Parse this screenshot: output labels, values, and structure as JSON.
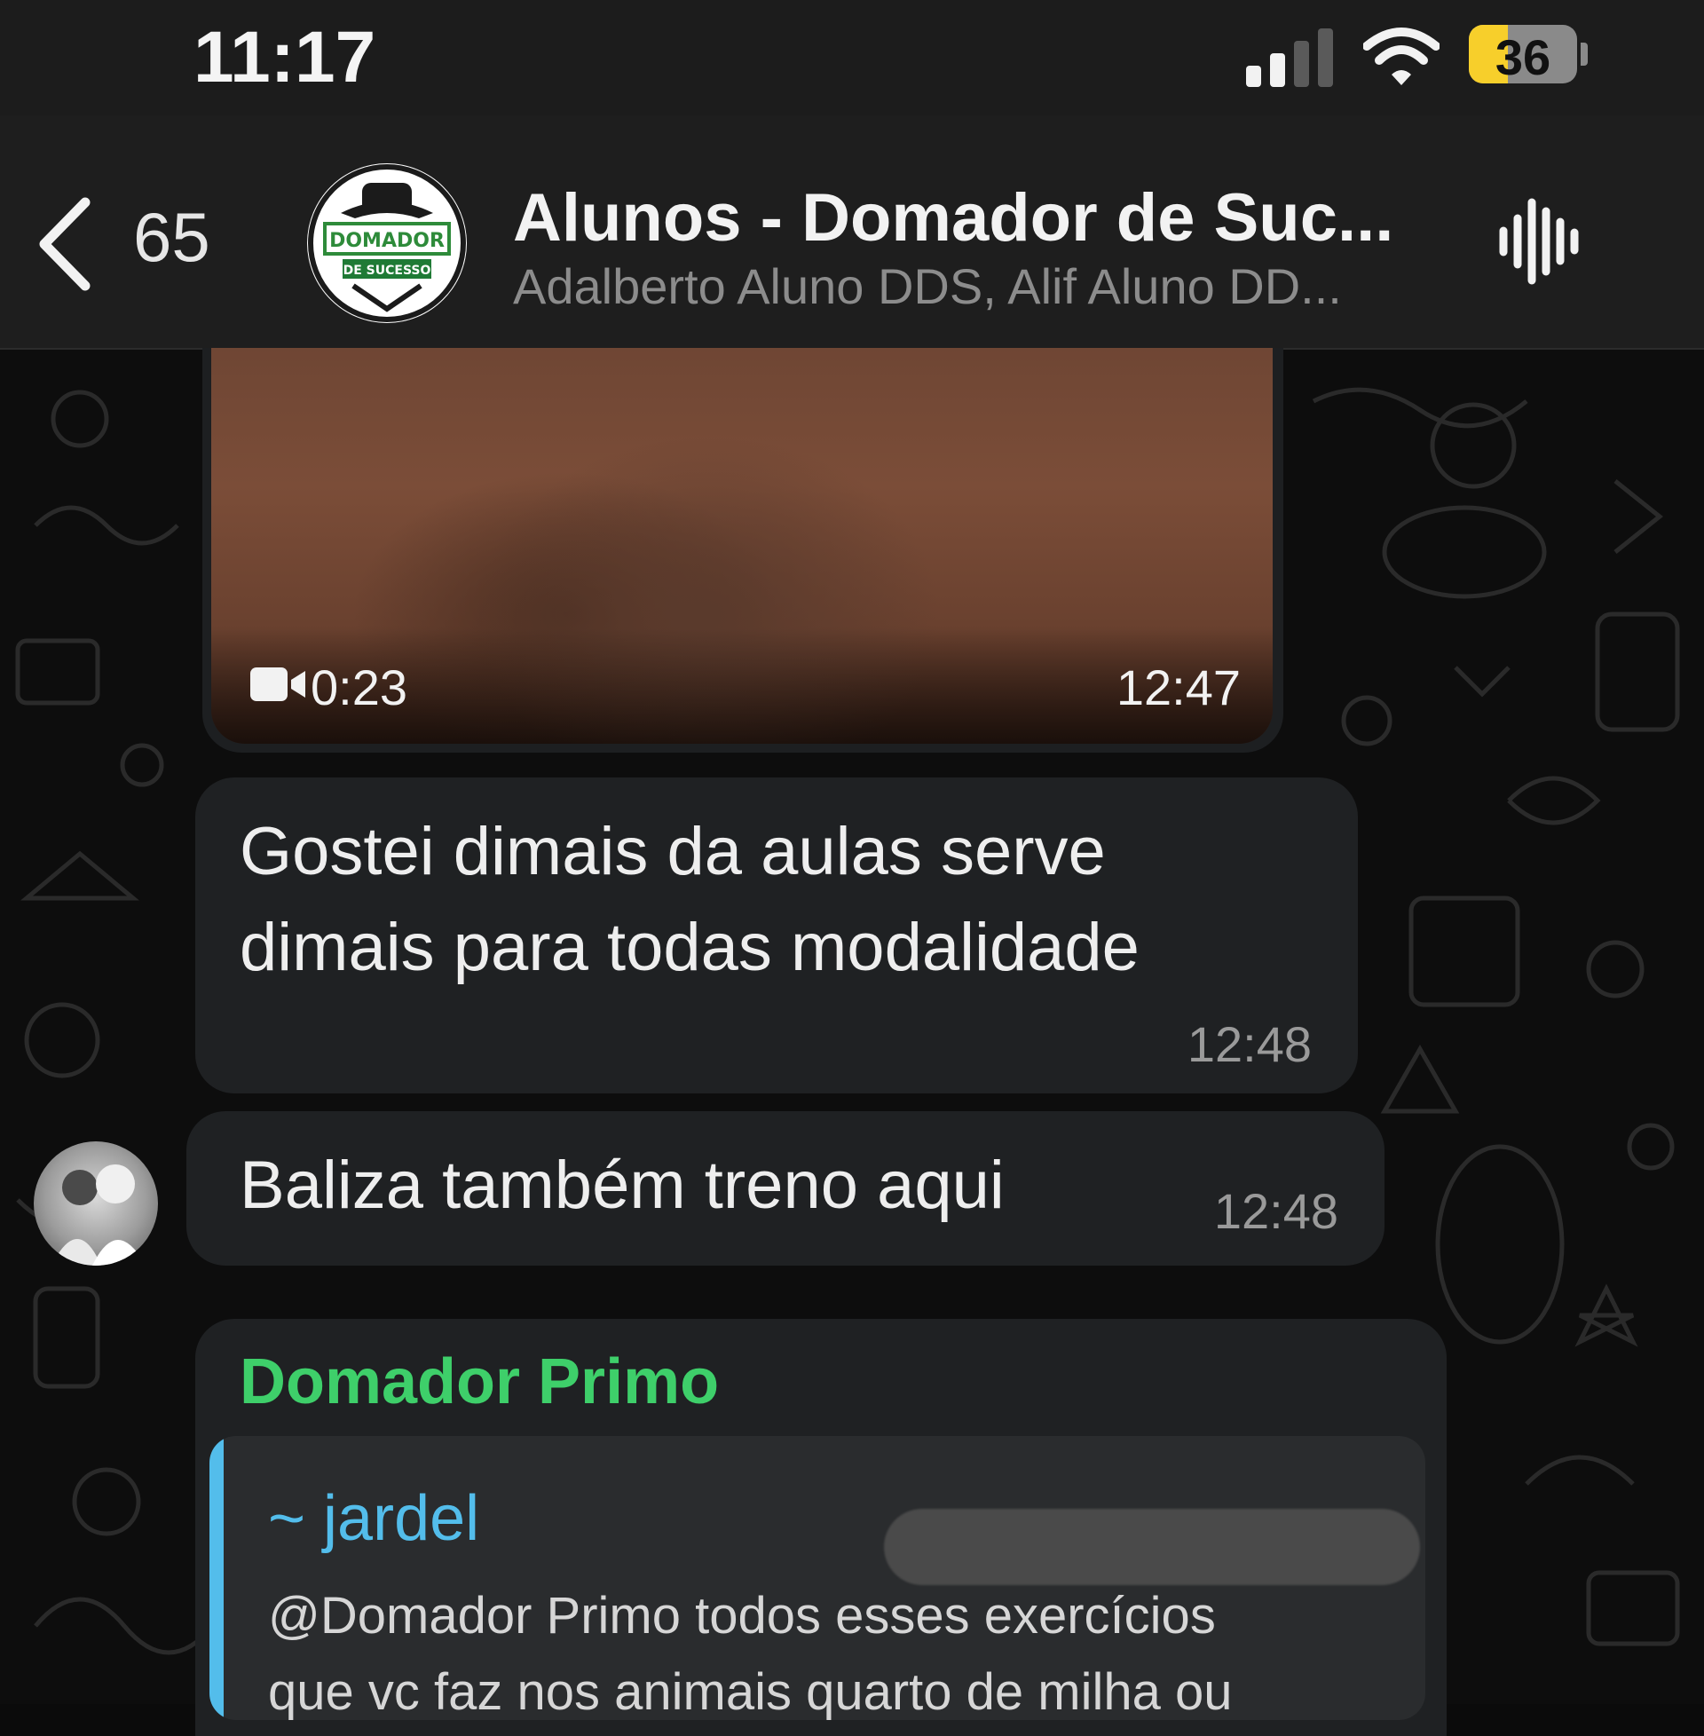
{
  "status_bar": {
    "time": "11:17",
    "battery": "36",
    "battery_color": "#f7cf2b",
    "signal_bars": 2,
    "wifi_icon": "wifi-icon"
  },
  "header": {
    "back_icon": "chevron-left-icon",
    "unread_count": "65",
    "title": "Alunos - Domador de Suc...",
    "members": "Adalberto Aluno DDS, Alif Aluno DD...",
    "avatar_text": [
      "DOMADOR",
      "DE SUCESSO"
    ],
    "voice_icon": "audio-waveform-icon"
  },
  "messages": [
    {
      "type": "video",
      "duration": "0:23",
      "time": "12:47",
      "icon": "video-camera-icon"
    },
    {
      "type": "text",
      "text_lines": [
        "Gostei dimais da aulas serve",
        "dimais para todas modalidade"
      ],
      "time": "12:48"
    },
    {
      "type": "text",
      "text": "Baliza também treno aqui",
      "time": "12:48"
    },
    {
      "type": "reply",
      "sender": "Domador Primo",
      "sender_color": "#3ecf6a",
      "quoted": {
        "author": "~ jardel",
        "author_color": "#53bdeb",
        "text_lines": [
          "@Domador Primo todos esses exercícios",
          "que vc faz nos animais quarto de milha ou"
        ]
      }
    }
  ]
}
